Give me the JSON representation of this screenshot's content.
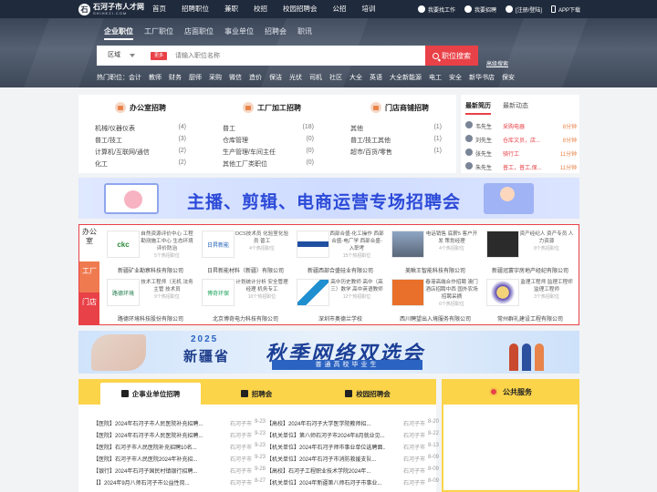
{
  "topbar": {
    "logo_main": "石河子市人才网",
    "logo_sub": "SHIHEZI.COM",
    "nav": [
      "首页",
      "招聘职位",
      "兼职",
      "校招",
      "校园招聘会",
      "公招",
      "培训"
    ],
    "right": [
      "我要找工作",
      "我要招聘",
      "[注册/登陆]",
      "APP下载"
    ]
  },
  "search": {
    "tabs": [
      "企业职位",
      "工厂职位",
      "店面职位",
      "事业单位",
      "招聘会",
      "职讯"
    ],
    "area_label": "区域",
    "more_label": "更多",
    "placeholder": "请输入职位名称",
    "button": "职位搜索",
    "advanced": "高级搜索",
    "hot": [
      "热门职位：会计",
      "教师",
      "财务",
      "厨师",
      "采购",
      "微信",
      "造价",
      "保洁",
      "光伏",
      "司机",
      "社区",
      "大全",
      "英语",
      "大全新能源",
      "电工",
      "安全",
      "新华书店",
      "保安"
    ]
  },
  "categories": [
    {
      "title": "办公室招聘",
      "rows": [
        {
          "name": "机械/仪器仪表",
          "count": "(4)"
        },
        {
          "name": "普工/技工",
          "count": "(3)"
        },
        {
          "name": "计算机/互联网/通信",
          "count": "(2)"
        },
        {
          "name": "化工",
          "count": "(2)"
        }
      ]
    },
    {
      "title": "工厂加工招聘",
      "rows": [
        {
          "name": "普工",
          "count": "(18)"
        },
        {
          "name": "仓库管理",
          "count": "(0)"
        },
        {
          "name": "生产管理/车间主任",
          "count": "(0)"
        },
        {
          "name": "其他工厂类职位",
          "count": "(0)"
        }
      ]
    },
    {
      "title": "门店商铺招聘",
      "rows": [
        {
          "name": "其他",
          "count": "(1)"
        },
        {
          "name": "普工/技工其他",
          "count": "(1)"
        },
        {
          "name": "超市/百货/零售",
          "count": "(1)"
        },
        {
          "name": "",
          "count": ""
        }
      ]
    }
  ],
  "news": {
    "tabs": [
      "最新简历",
      "最新动态"
    ],
    "rows": [
      {
        "name": "韦先生",
        "job": "采购电器",
        "time": "8分钟"
      },
      {
        "name": "刘先生",
        "job": "仓库文员，店...",
        "time": "8分钟"
      },
      {
        "name": "张先生",
        "job": "骑行工",
        "time": "11分钟"
      },
      {
        "name": "朱先生",
        "job": "普工，普工,保...",
        "time": "11分钟"
      }
    ]
  },
  "banner1": {
    "title": "主播、剪辑、电商运营专场招聘会"
  },
  "companies": {
    "side": [
      "办公室",
      "工厂",
      "门店"
    ],
    "items": [
      {
        "logo": "ckc",
        "desc": "自然资源评价中心 工程勘测施工中心 生态环境评价防治",
        "hot": "5个热招职位",
        "name": "新疆矿业勘察科技有限公司"
      },
      {
        "logo": "日昇新能",
        "desc": "DCS技术员 化验室化验员 普工",
        "hot": "4个热招职位",
        "name": "日昇新能材料（新疆）有限公司"
      },
      {
        "logo": "logo",
        "desc": "西部合盛-化工操作 西部合盛-电厂学 西部合盛-入职考",
        "hot": "15个热招职位",
        "name": "新疆西部合盛硅业有限公司"
      },
      {
        "logo": "photo",
        "desc": "电话销售 底薪5 客户开发 策划经理",
        "hot": "4个热招职位",
        "name": "美瞅王智能科技有限公司"
      },
      {
        "logo": "logo",
        "desc": "资产经纪人 资产专员 人力资源",
        "hot": "8个热招职位",
        "name": "新疆冠寰宇房地产经纪有限公司"
      },
      {
        "logo": "路德环境",
        "desc": "技术工程师（无机 法务主管 技术员",
        "hot": "9个热招职位",
        "name": "路德环境科技股份有限公司"
      },
      {
        "logo": "博奇环保",
        "desc": "计划统计分析 安全管理经理 机务专工",
        "hot": "10个热招职位",
        "name": "北京博奇电力科技有限公司"
      },
      {
        "logo": "logo",
        "desc": "高中历史教师 高中（高三）数学 高中英语教师",
        "hot": "12个热招职位",
        "name": "深圳市奥德兰学校"
      },
      {
        "logo": "logo",
        "desc": "春港高端合作招聘 澳门酒店招聘中西 国外农场招聘采摘",
        "hot": "6个热招职位",
        "name": "西川聘望出入境服务有限公司"
      },
      {
        "logo": "logo",
        "desc": "监理工程师 监理工程师 监理工程师",
        "hot": "3个热招职位",
        "name": "常州群礼建设工程有限公司"
      }
    ]
  },
  "banner2": {
    "year": "2025",
    "province": "新疆省",
    "title": "秋季网络双选会",
    "sub": "普通高校毕业生"
  },
  "sections": {
    "tabs": [
      "企事业单位招聘",
      "招聘会",
      "校园招聘会"
    ],
    "left": [
      {
        "t": "【医院】2024年石河子市人民医院补充招聘...",
        "c": "石河子市",
        "d": "9-23"
      },
      {
        "t": "【医院】2024年石河子市人民医院补充招聘...",
        "c": "石河子市",
        "d": "9-23"
      },
      {
        "t": "【医院】石河子市人民医院补充招聘10名...",
        "c": "石河子市",
        "d": "9-23"
      },
      {
        "t": "【医院】石河子市人民医院2024年补充招...",
        "c": "石河子市",
        "d": "9-23"
      },
      {
        "t": "【银行】2024年石河子国民村镇银行招聘...",
        "c": "石河子市",
        "d": "9-28"
      },
      {
        "t": "【】2024年9月八师石河子市公益性岗...",
        "c": "石河子市",
        "d": "8-27"
      }
    ],
    "right": [
      {
        "t": "【高校】2024年石河子大学医学院教师招...",
        "c": "石河子市",
        "d": "8-20"
      },
      {
        "t": "【机关单位】第八师石河子市2024年8月就业见...",
        "c": "石河子市",
        "d": "8-22"
      },
      {
        "t": "【机关单位】2024年石河子师市事业单位选聘面...",
        "c": "石河子市",
        "d": "8-13"
      },
      {
        "t": "【机关单位】2024年石河子市消防救援支队...",
        "c": "石河子市",
        "d": "8-09"
      },
      {
        "t": "【高校】石河子工程职业技术学院2024年...",
        "c": "石河子市",
        "d": "8-09"
      },
      {
        "t": "【机关单位】2024年新疆第八师石河子市事业...",
        "c": "石河子市",
        "d": "8-09"
      }
    ]
  },
  "public": {
    "title": "公共服务"
  },
  "colors": {
    "accent": "#e84147",
    "dark": "#1f2a3c",
    "yellow": "#fbd44a"
  }
}
